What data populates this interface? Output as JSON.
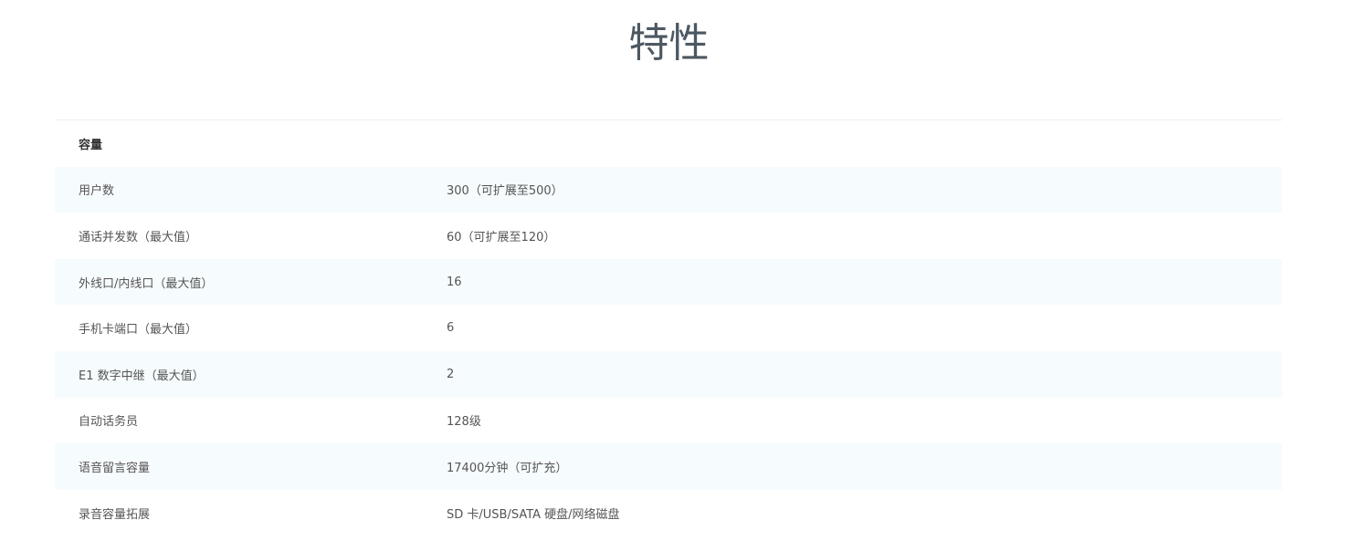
{
  "page": {
    "title": "特性"
  },
  "spec_table": {
    "header": "容量",
    "rows": [
      {
        "label": "用户数",
        "value": "300（可扩展至500）"
      },
      {
        "label": "通话并发数（最大值）",
        "value": "60（可扩展至120）"
      },
      {
        "label": "外线口/内线口（最大值）",
        "value": "16"
      },
      {
        "label": "手机卡端口（最大值）",
        "value": "6"
      },
      {
        "label": "E1 数字中继（最大值）",
        "value": "2"
      },
      {
        "label": "自动话务员",
        "value": "128级"
      },
      {
        "label": "语音留言容量",
        "value": "17400分钟（可扩充）"
      },
      {
        "label": "录音容量拓展",
        "value": "SD 卡/USB/SATA 硬盘/网络磁盘"
      }
    ]
  }
}
